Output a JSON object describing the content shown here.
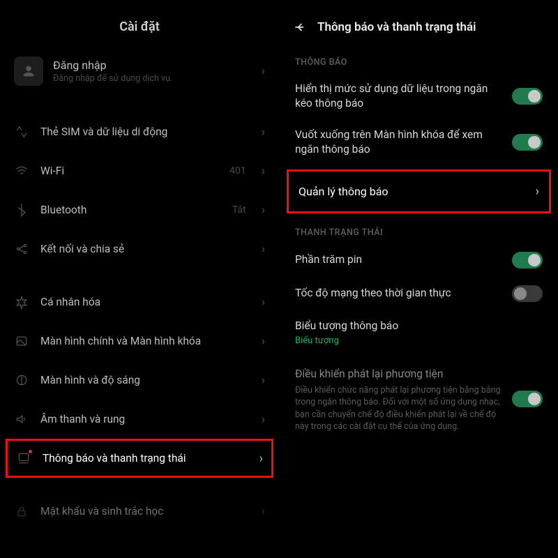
{
  "panel_left": {
    "title": "Cài đặt",
    "account": {
      "title": "Đăng nhập",
      "subtitle": "Đăng nhập để sử dụng dịch vụ."
    },
    "rows": {
      "sim": {
        "label": "Thẻ SIM và dữ liệu di động"
      },
      "wifi": {
        "label": "Wi-Fi",
        "trail": "401"
      },
      "bluetooth": {
        "label": "Bluetooth",
        "trail": "Tắt"
      },
      "share": {
        "label": "Kết nối và chia sẻ"
      },
      "personalize": {
        "label": "Cá nhân hóa"
      },
      "home_lock": {
        "label": "Màn hình chính và Màn hình khóa"
      },
      "display": {
        "label": "Màn hình và độ sáng"
      },
      "sound": {
        "label": "Âm thanh và rung"
      },
      "notifications": {
        "label": "Thông báo và thanh trạng thái"
      },
      "password": {
        "label": "Mật khẩu và sinh trắc học"
      }
    }
  },
  "panel_right": {
    "title": "Thông báo và thanh trạng thái",
    "section_notif": "THÔNG BÁO",
    "rows": {
      "data_usage": {
        "label": "Hiển thị mức sử dụng dữ liệu trong ngăn kéo thông báo",
        "toggle": "on"
      },
      "swipe_lock": {
        "label": "Vuốt xuống trên Màn hình khóa để xem ngăn thông báo",
        "toggle": "on"
      },
      "manage": {
        "label": "Quản lý thông báo"
      }
    },
    "section_status": "THANH TRẠNG THÁI",
    "status_rows": {
      "battery_pct": {
        "label": "Phần trăm pin",
        "toggle": "on"
      },
      "net_speed": {
        "label": "Tốc độ mạng theo thời gian thực",
        "toggle": "off"
      },
      "notif_icons": {
        "label": "Biểu tượng thông báo",
        "sub": "Biểu tượng"
      },
      "media": {
        "label": "Điều khiển phát lại phương tiện",
        "desc": "Điều khiển chức năng phát lại phương tiện bằng bảng trong ngăn thông báo. Đối với một số ứng dụng nhạc, bạn cần chuyển chế độ điều khiển phát lại về chế độ này trong các cài đặt cụ thể của ứng dụng.",
        "toggle": "on"
      }
    }
  }
}
